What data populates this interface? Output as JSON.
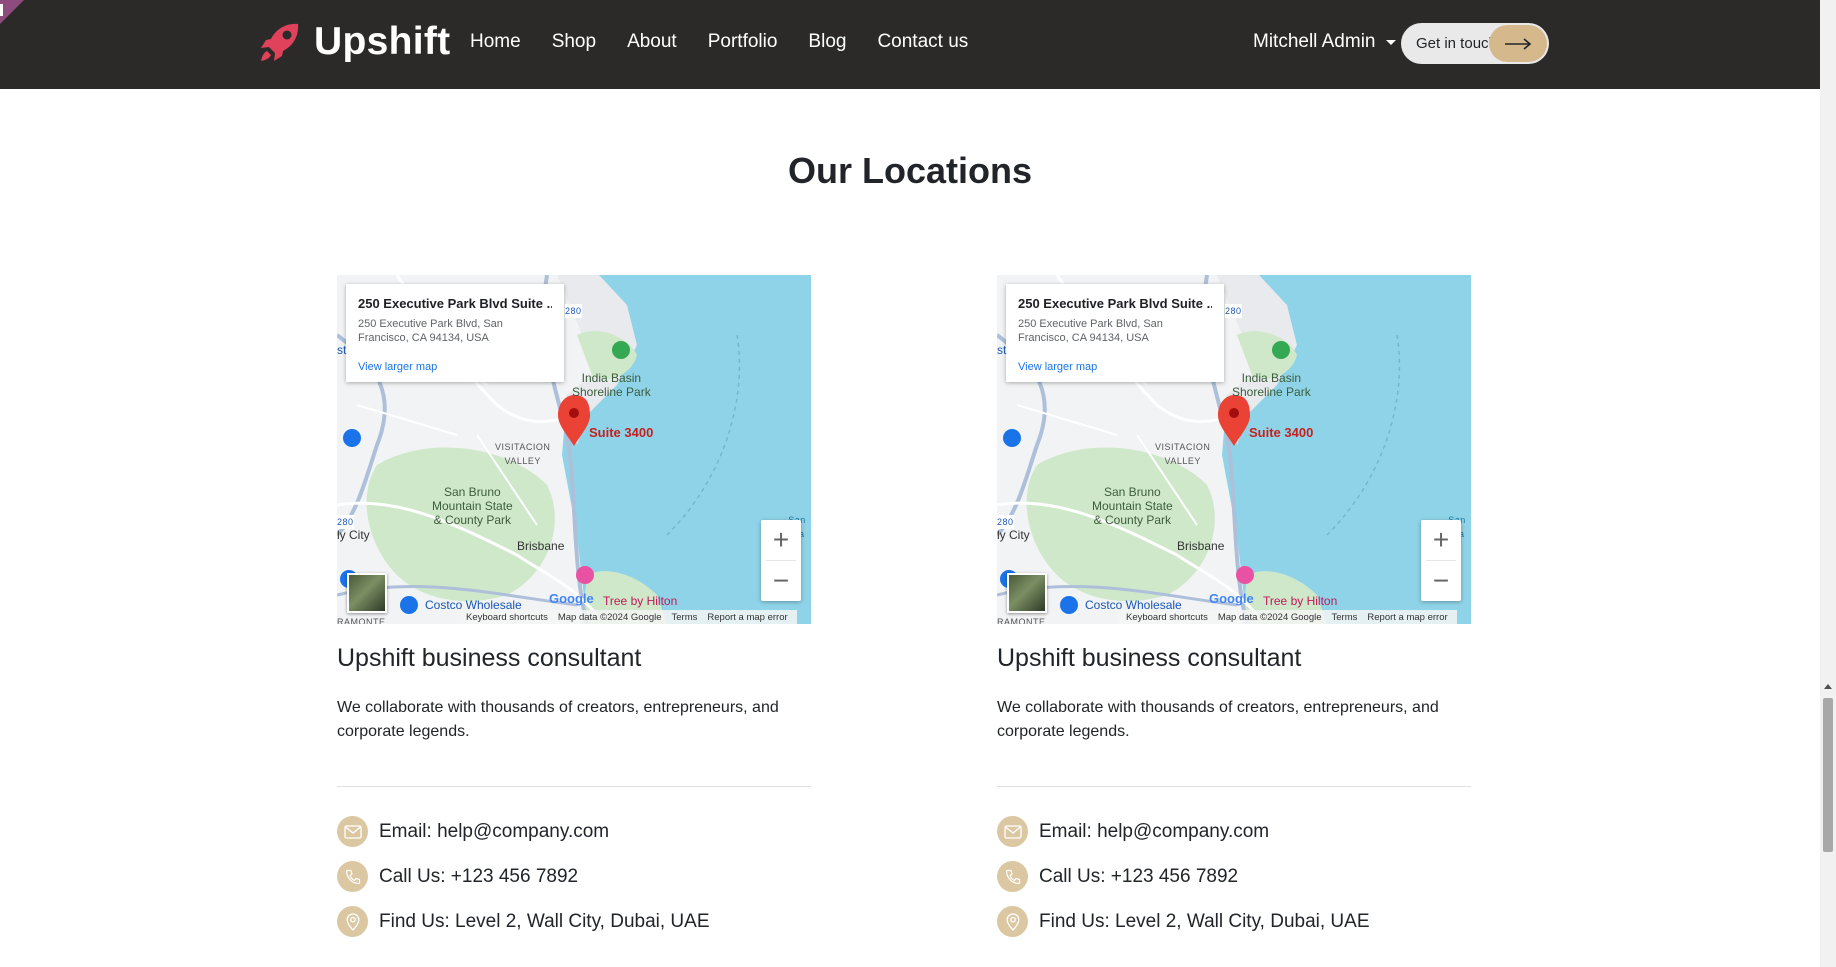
{
  "brand": {
    "name": "Upshift"
  },
  "nav": {
    "items": [
      "Home",
      "Shop",
      "About",
      "Portfolio",
      "Blog",
      "Contact us"
    ]
  },
  "user": {
    "name": "Mitchell Admin"
  },
  "cta": {
    "label": "Get in touch"
  },
  "section": {
    "title": "Our Locations"
  },
  "locations": [
    {
      "map": {
        "place_title": "250 Executive Park Blvd Suite ...",
        "address_line1": "250 Executive Park Blvd, San",
        "address_line2": "Francisco, CA 94134, USA",
        "view_larger": "View larger map",
        "pin_label": "Suite 3400",
        "labels": {
          "park": "India Basin\nShoreline Park",
          "valley": "VISITACION\nVALLEY",
          "mountain": "San Bruno\nMountain State\n& County Park",
          "city": "ly City",
          "brisbane": "Brisbane",
          "costco": "Costco Wholesale",
          "hotel": "Tree by Hilton",
          "ramonte": "RAMONTE",
          "highway": "280",
          "sanfra": "San Fra",
          "st": "st"
        },
        "footer": [
          "Keyboard shortcuts",
          "Map data ©2024 Google",
          "Terms",
          "Report a map error"
        ],
        "google": "Google",
        "zoom_in": "+",
        "zoom_out": "−"
      },
      "title": "Upshift business consultant",
      "description": "We collaborate with thousands of creators, entrepreneurs, and corporate legends.",
      "email": "Email: help@company.com",
      "phone": "Call Us: +123 456 7892",
      "address": "Find Us: Level 2, Wall City, Dubai, UAE"
    },
    {
      "map": {
        "place_title": "250 Executive Park Blvd Suite ...",
        "address_line1": "250 Executive Park Blvd, San",
        "address_line2": "Francisco, CA 94134, USA",
        "view_larger": "View larger map",
        "pin_label": "Suite 3400",
        "labels": {
          "park": "India Basin\nShoreline Park",
          "valley": "VISITACION\nVALLEY",
          "mountain": "San Bruno\nMountain State\n& County Park",
          "city": "ly City",
          "brisbane": "Brisbane",
          "costco": "Costco Wholesale",
          "hotel": "Tree by Hilton",
          "ramonte": "RAMONTE",
          "highway": "280",
          "sanfra": "San Fra",
          "st": "st"
        },
        "footer": [
          "Keyboard shortcuts",
          "Map data ©2024 Google",
          "Terms",
          "Report a map error"
        ],
        "google": "Google",
        "zoom_in": "+",
        "zoom_out": "−"
      },
      "title": "Upshift business consultant",
      "description": "We collaborate with thousands of creators, entrepreneurs, and corporate legends.",
      "email": "Email: help@company.com",
      "phone": "Call Us: +123 456 7892",
      "address": "Find Us: Level 2, Wall City, Dubai, UAE"
    }
  ],
  "colors": {
    "navbar_bg": "#2b2a29",
    "accent": "#d5b98d",
    "brand_icon": "#e0425b",
    "icon_bg": "#dcc7a3"
  },
  "icons": {
    "brand": "rocket-icon",
    "email": "envelope-icon",
    "phone": "phone-icon",
    "address": "location-pin-icon",
    "cta": "arrow-right-icon"
  }
}
